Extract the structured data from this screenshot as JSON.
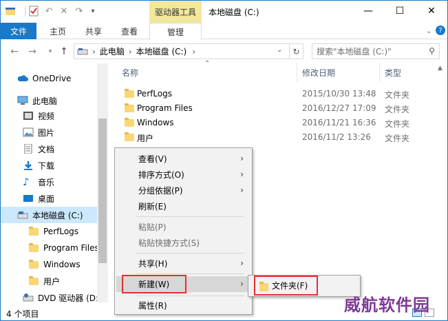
{
  "title_bar": {
    "drive_tools": "驱动器工具",
    "window_title": "本地磁盘 (C:)",
    "minimize": "—",
    "maximize": "☐",
    "close": "✕"
  },
  "ribbon": {
    "tabs": [
      "文件",
      "主页",
      "共享",
      "查看"
    ],
    "manage": "管理"
  },
  "address": {
    "crumbs": [
      "此电脑",
      "本地磁盘 (C:)"
    ],
    "search_placeholder": "搜索\"本地磁盘 (C:)\""
  },
  "nav_pane": {
    "items": [
      {
        "label": "OneDrive",
        "icon": "cloud-icon"
      },
      {
        "label": "此电脑",
        "icon": "computer-icon"
      },
      {
        "label": "视频",
        "icon": "video-icon"
      },
      {
        "label": "图片",
        "icon": "pictures-icon"
      },
      {
        "label": "文档",
        "icon": "documents-icon"
      },
      {
        "label": "下载",
        "icon": "download-icon"
      },
      {
        "label": "音乐",
        "icon": "music-icon"
      },
      {
        "label": "桌面",
        "icon": "desktop-icon"
      },
      {
        "label": "本地磁盘 (C:)",
        "icon": "drive-icon"
      },
      {
        "label": "PerfLogs",
        "icon": "folder-icon"
      },
      {
        "label": "Program Files",
        "icon": "folder-icon"
      },
      {
        "label": "Windows",
        "icon": "folder-icon"
      },
      {
        "label": "用户",
        "icon": "folder-icon"
      },
      {
        "label": "DVD 驱动器 (D:",
        "icon": "dvd-icon"
      }
    ]
  },
  "file_list": {
    "columns": {
      "name": "名称",
      "date": "修改日期",
      "type": "类型"
    },
    "rows": [
      {
        "name": "PerfLogs",
        "date": "2015/10/30 13:48",
        "type": "文件夹"
      },
      {
        "name": "Program Files",
        "date": "2016/12/27 17:09",
        "type": "文件夹"
      },
      {
        "name": "Windows",
        "date": "2016/11/21 16:36",
        "type": "文件夹"
      },
      {
        "name": "用户",
        "date": "2016/11/2 13:26",
        "type": "文件夹"
      }
    ]
  },
  "status": {
    "count": "4 个项目"
  },
  "context_menu": {
    "view": "查看(V)",
    "sort": "排序方式(O)",
    "group": "分组依据(P)",
    "refresh": "刷新(E)",
    "paste": "粘贴(P)",
    "paste_shortcut": "粘贴快捷方式(S)",
    "share": "共享(H)",
    "new": "新建(W)",
    "properties": "属性(R)"
  },
  "submenu": {
    "folder": "文件夹(F)"
  },
  "watermark": "威航软件园",
  "colors": {
    "accent": "#1979ca",
    "drive_tools": "#f2e79d",
    "highlight_box": "#e0312f"
  }
}
